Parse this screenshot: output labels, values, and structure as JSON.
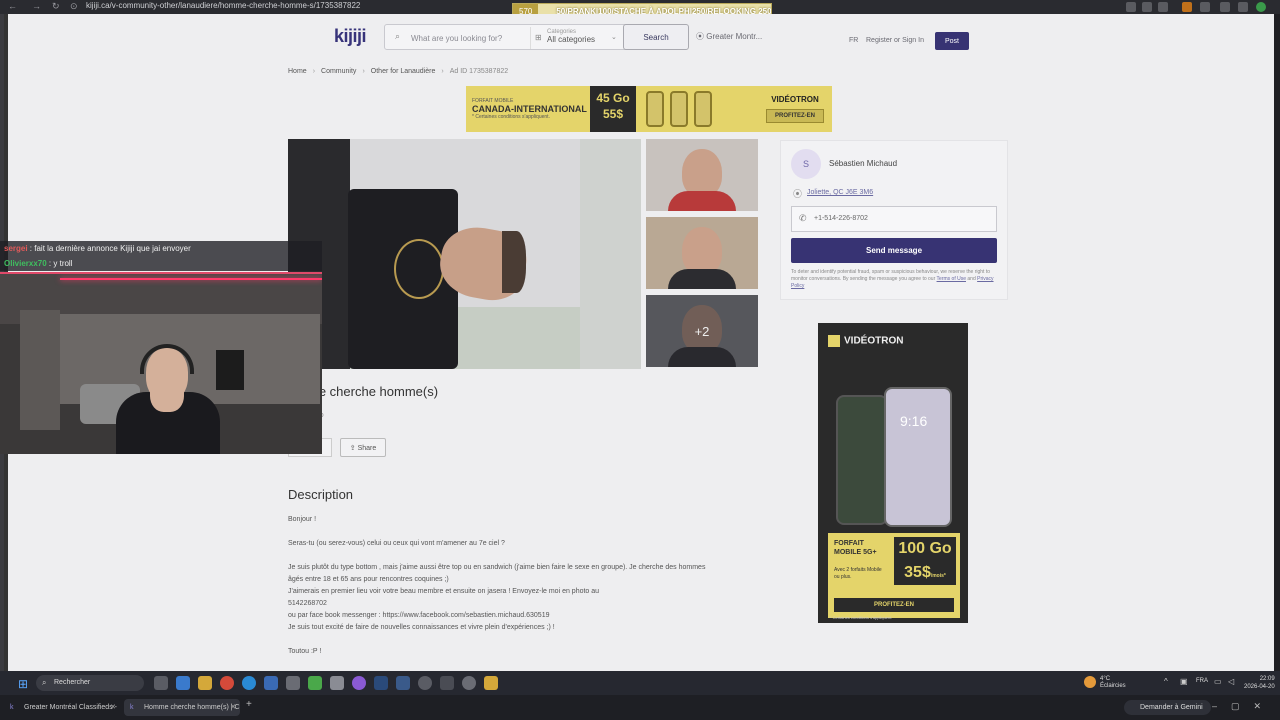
{
  "browser": {
    "url": "kijiji.ca/v-community-other/lanaudiere/homme-cherche-homme-s/1735387822",
    "stream_ticker_left": "570",
    "stream_ticker": "50/PRANK|100/STACHE À ADOLPH|250/RELOOKING 250"
  },
  "header": {
    "logo": "kijiji",
    "search_placeholder": "What are you looking for?",
    "category_label": "Categories",
    "category_value": "All categories",
    "search_button": "Search",
    "location": "Greater Montr...",
    "lang": "FR",
    "register": "Register or Sign In",
    "post_button": "Post"
  },
  "breadcrumb": {
    "home": "Home",
    "community": "Community",
    "other": "Other for Lanaudière",
    "ad_id": "Ad ID 1735387822"
  },
  "top_ad": {
    "small": "FORFAIT MOBILE",
    "headline": "CANADA-INTERNATIONAL",
    "data": "45 Go",
    "price": "55$",
    "fine": "* Certaines conditions s'appliquent.",
    "brand": "VIDÉOTRON",
    "cta": "PROFITEZ-EN"
  },
  "gallery": {
    "more_count": "+2"
  },
  "seller": {
    "initial": "S",
    "name": "Sébastien Michaud",
    "location": "Joliette, QC J6E 3M6",
    "phone": "+1-514-226-8702",
    "send_button": "Send message",
    "disclaimer_text": "To deter and identify potential fraud, spam or suspicious behaviour, we reserve the right to monitor conversations. By sending the message you agree to our ",
    "terms_link": "Terms of Use",
    "and": " and ",
    "privacy_link": "Privacy Policy"
  },
  "side_ad": {
    "brand": "VIDÉOTRON",
    "time": "9:16",
    "offer_title": "FORFAIT MOBILE 5G+",
    "offer_sub": "Avec 2 forfaits Mobile ou plus.",
    "data": "100 Go",
    "price": "35$",
    "price_unit": "/mois*",
    "cta": "PROFITEZ-EN",
    "fine": "* Certaines conditions s'appliquent."
  },
  "listing": {
    "title": "me cherche homme(s)",
    "posted": "ago",
    "save_button": "",
    "share_button": "Share",
    "description_heading": "Description",
    "description_lines": [
      "Bonjour !",
      "",
      "Seras-tu (ou serez-vous) celui ou ceux qui vont m'amener au 7e ciel ?",
      "",
      "Je suis plutôt du type bottom , mais j'aime aussi être top ou en sandwich (j'aime bien faire le sexe en groupe). Je cherche des hommes",
      "âgés entre 18 et 65 ans pour rencontres coquines ;)",
      "J'aimerais en premier lieu voir votre beau membre et ensuite on jasera ! Envoyez-le moi en photo au",
      "5142268702",
      "ou par face book messenger : https://www.facebook.com/sebastien.michaud.630519",
      "Je suis tout excité de faire de nouvelles connaissances et vivre plein d'expériences ;) !",
      "",
      "Toutou :P !"
    ]
  },
  "chat": {
    "user1": "sergei",
    "msg1": " : fait la dernière annonce Kijiji que jai envoyer",
    "user2": "Olivierxx70",
    "msg2": " : y troll"
  },
  "taskbar": {
    "search": "Rechercher",
    "weather_temp": "4°C",
    "weather_desc": "Éclaircies",
    "lang": "FRA",
    "time": "22:09",
    "date": "2026-04-20"
  },
  "tabs": [
    {
      "label": "Greater Montréal Classifieds -"
    },
    {
      "label": "Homme cherche homme(s) | C"
    }
  ],
  "gemini": "Demander à Gemini",
  "colors": {
    "brand": "#373373",
    "ad_yellow": "#e4d46a"
  }
}
